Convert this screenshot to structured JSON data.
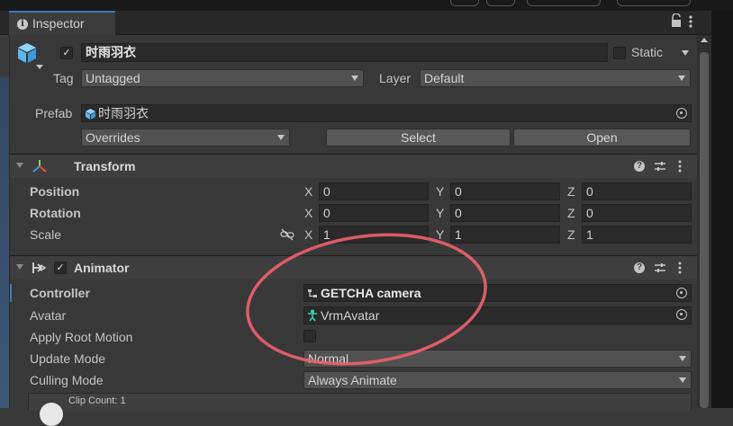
{
  "window": {
    "tab_label": "Inspector",
    "lock_icon": "lock-icon",
    "menu_icon": "kebab-menu-icon"
  },
  "gameobject": {
    "name": "时雨羽衣",
    "active": true,
    "static_label": "Static",
    "tag_label": "Tag",
    "tag_value": "Untagged",
    "layer_label": "Layer",
    "layer_value": "Default",
    "prefab_label": "Prefab",
    "prefab_value": "时雨羽衣",
    "overrides_value": "Overrides",
    "select_label": "Select",
    "open_label": "Open"
  },
  "transform": {
    "title": "Transform",
    "rows": [
      {
        "label": "Position",
        "x": "0",
        "y": "0",
        "z": "0"
      },
      {
        "label": "Rotation",
        "x": "0",
        "y": "0",
        "z": "0"
      },
      {
        "label": "Scale",
        "x": "1",
        "y": "1",
        "z": "1"
      }
    ],
    "axis_x": "X",
    "axis_y": "Y",
    "axis_z": "Z"
  },
  "animator": {
    "title": "Animator",
    "enabled": true,
    "controller_label": "Controller",
    "controller_value": "GETCHA camera",
    "avatar_label": "Avatar",
    "avatar_value": "VrmAvatar",
    "root_motion_label": "Apply Root Motion",
    "update_mode_label": "Update Mode",
    "update_mode_value": "Normal",
    "culling_label": "Culling Mode",
    "culling_value": "Always Animate",
    "clip_count": "Clip Count: 1"
  },
  "colors": {
    "background": "#383838",
    "accent": "#3a79bb",
    "annotation_circle": "#f0606e"
  }
}
